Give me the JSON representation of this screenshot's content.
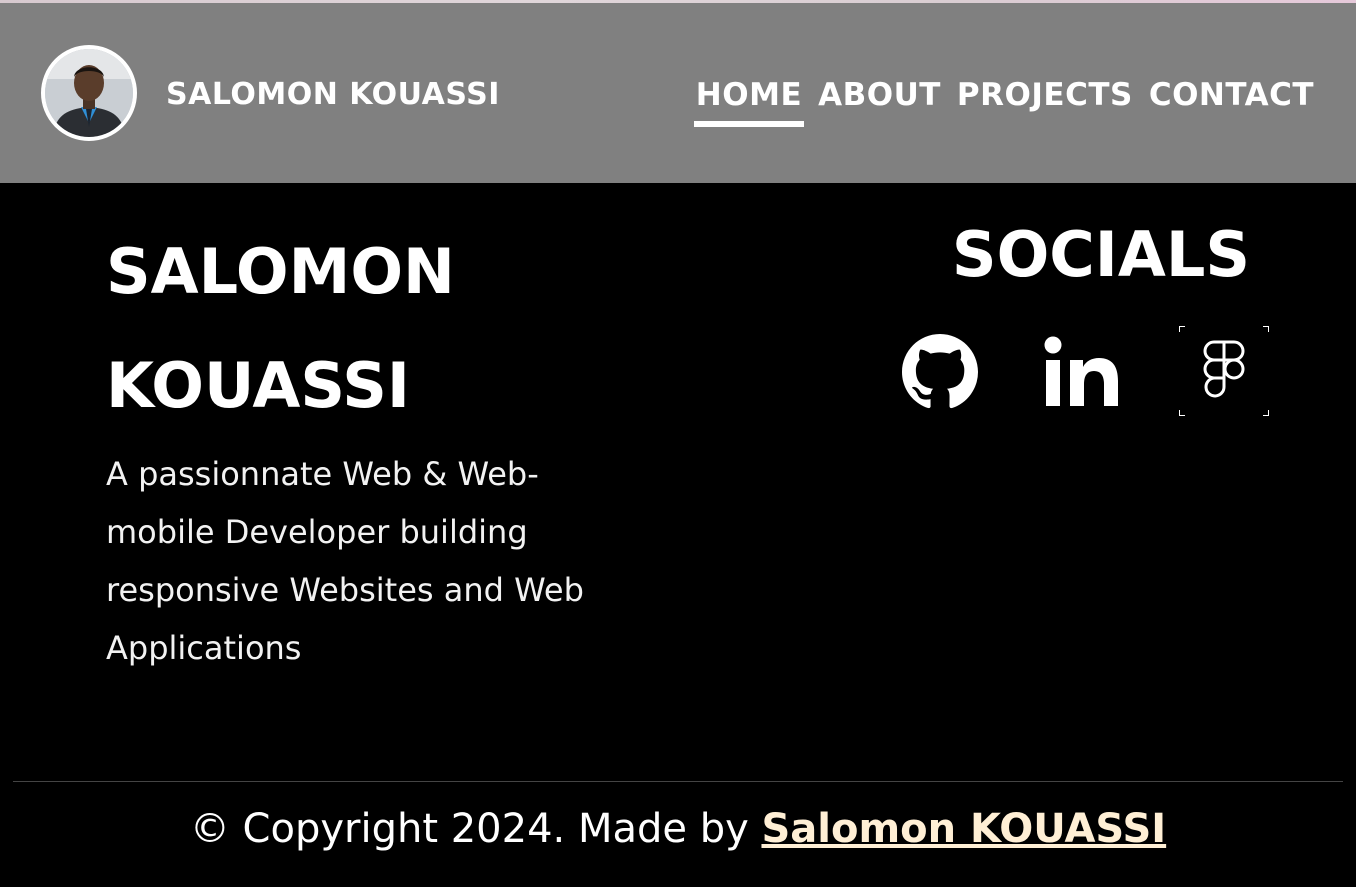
{
  "header": {
    "brand_name": "SALOMON KOUASSI",
    "avatar_alt": "Profile photo of Salomon Kouassi",
    "nav": [
      {
        "label": "HOME",
        "active": true
      },
      {
        "label": "ABOUT",
        "active": false
      },
      {
        "label": "PROJECTS",
        "active": false
      },
      {
        "label": "CONTACT",
        "active": false
      }
    ]
  },
  "hero": {
    "name_line1": "SALOMON",
    "name_line2": "KOUASSI",
    "description": "A passionnate Web & Web-mobile Developer building responsive Websites and Web Applications"
  },
  "socials": {
    "title": "SOCIALS",
    "icons": [
      "github-icon",
      "linkedin-icon",
      "figma-icon"
    ]
  },
  "footer": {
    "text": "© Copyright 2024. Made by ",
    "link_label": "Salomon KOUASSI"
  },
  "colors": {
    "header_bg": "#808080",
    "page_bg": "#000000",
    "text": "#ffffff",
    "footer_link": "#ffefd5"
  }
}
